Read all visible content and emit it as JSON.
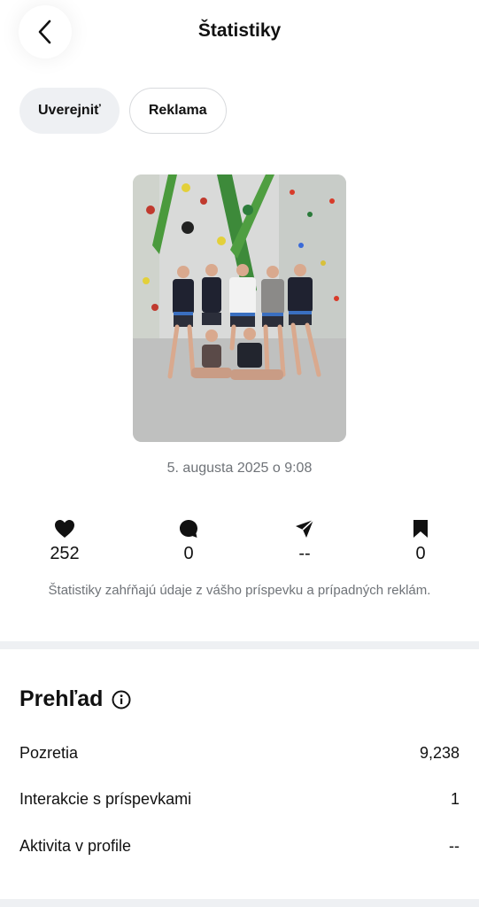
{
  "header": {
    "title": "Štatistiky",
    "back_icon": "chevron-left-icon"
  },
  "chips": {
    "publish_label": "Uverejniť",
    "ad_label": "Reklama"
  },
  "post": {
    "date": "5. augusta 2025 o 9:08",
    "photo_icon": "post-photo"
  },
  "stats": {
    "likes": {
      "icon": "heart-icon",
      "value": "252"
    },
    "comments": {
      "icon": "comment-icon",
      "value": "0"
    },
    "shares": {
      "icon": "send-icon",
      "value": "--"
    },
    "saves": {
      "icon": "bookmark-icon",
      "value": "0"
    }
  },
  "note": "Štatistiky zahŕňajú údaje z vášho príspevku a prípadných reklám.",
  "overview": {
    "title": "Prehľad",
    "info_icon": "info-icon",
    "rows": [
      {
        "label": "Pozretia",
        "value": "9,238"
      },
      {
        "label": "Interakcie s príspevkami",
        "value": "1"
      },
      {
        "label": "Aktivita v profile",
        "value": "--"
      }
    ]
  },
  "colors": {
    "chip_active_bg": "#eef0f3",
    "muted_text": "#6f7378",
    "divider": "#eef0f3"
  }
}
